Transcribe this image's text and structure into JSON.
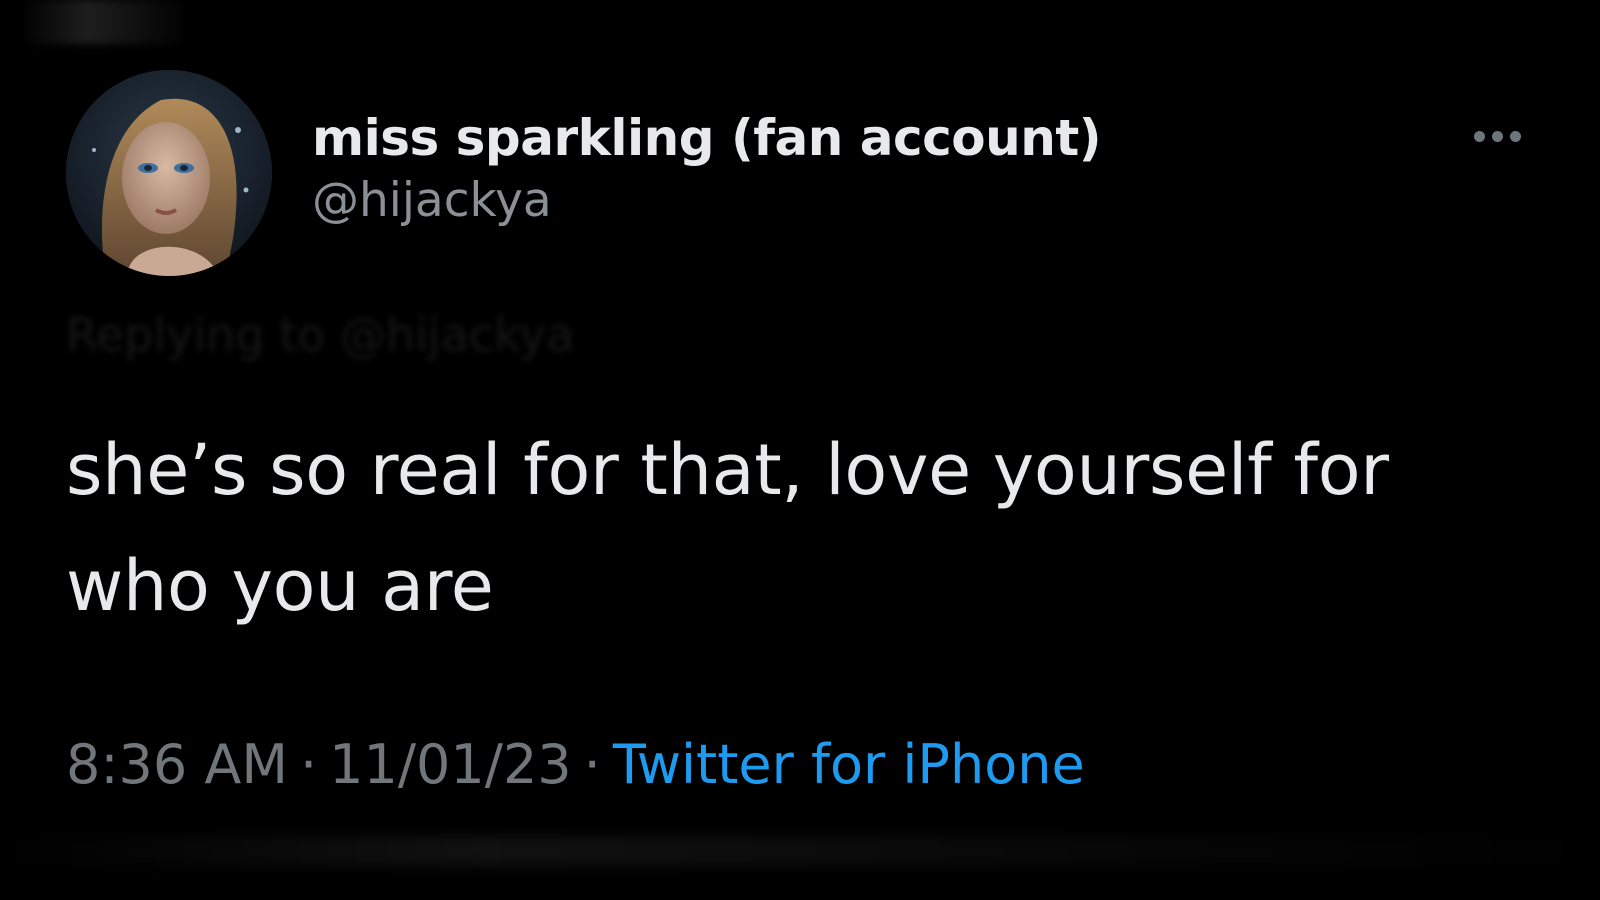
{
  "tweet": {
    "author": {
      "display_name": "miss sparkling (fan account)",
      "handle": "@hijackya",
      "avatar_icon": "profile-photo"
    },
    "replying_to": "Replying to @hijackya",
    "text": "she’s so real for that, love yourself for who you are",
    "meta": {
      "time": "8:36 AM",
      "separator": "·",
      "date": "11/01/23",
      "source": "Twitter for iPhone"
    },
    "more_icon": "more-horizontal-icon"
  },
  "colors": {
    "background": "#000000",
    "primary_text": "#e7e9ea",
    "secondary_text": "#71767b",
    "link": "#1d9bf0"
  }
}
